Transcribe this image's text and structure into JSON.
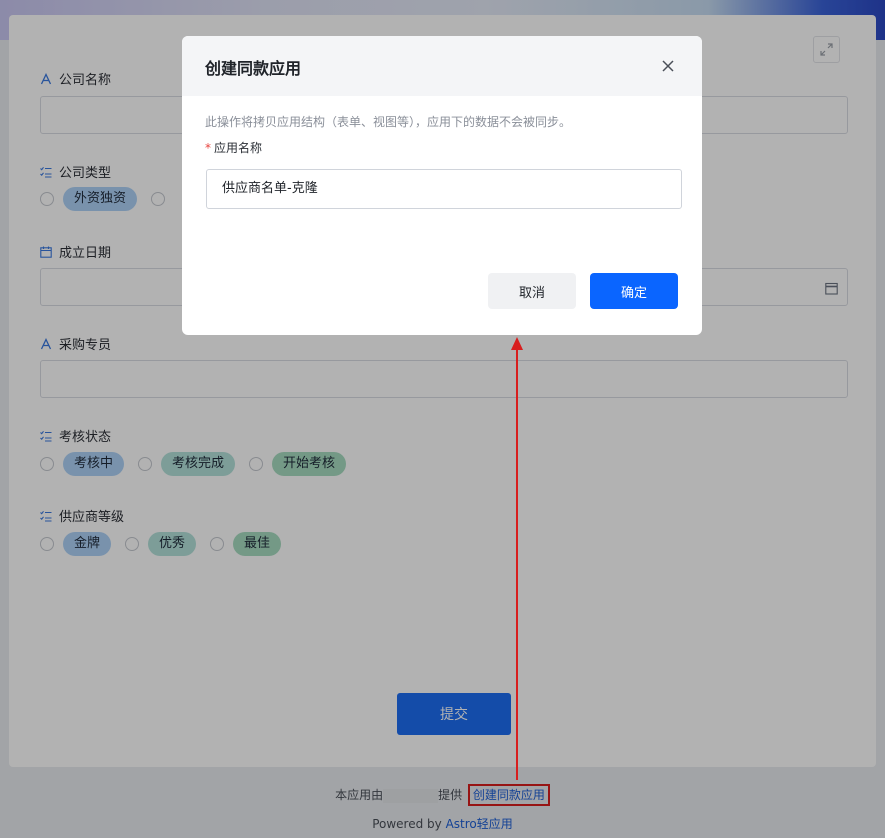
{
  "form": {
    "fields": [
      {
        "label": "公司名称",
        "type": "text",
        "icon": "text-field-icon"
      },
      {
        "label": "公司类型",
        "type": "radio",
        "icon": "list-check-icon",
        "options": [
          "外资独资"
        ]
      },
      {
        "label": "成立日期",
        "type": "date",
        "icon": "calendar-icon"
      },
      {
        "label": "采购专员",
        "type": "text",
        "icon": "text-field-icon"
      },
      {
        "label": "考核状态",
        "type": "radio",
        "icon": "list-check-icon",
        "options": [
          "考核中",
          "考核完成",
          "开始考核"
        ]
      },
      {
        "label": "供应商等级",
        "type": "radio",
        "icon": "list-check-icon",
        "options": [
          "金牌",
          "优秀",
          "最佳"
        ]
      }
    ],
    "submit_label": "提交",
    "tag_colors": {
      "blue": "#aed2f7",
      "teal": "#b3e1da",
      "green": "#a6dcc0"
    }
  },
  "footer": {
    "provided_prefix": "本应用由",
    "provided_suffix": "提供",
    "create_link": "创建同款应用",
    "powered_by": "Powered by",
    "brand": "Astro轻应用"
  },
  "modal": {
    "title": "创建同款应用",
    "description": "此操作将拷贝应用结构（表单、视图等），应用下的数据不会被同步。",
    "field_label": "应用名称",
    "field_value": "供应商名单-克隆",
    "cancel_label": "取消",
    "confirm_label": "确定"
  },
  "colors": {
    "accent": "#0a65ff",
    "annotation": "#d81e1e"
  }
}
